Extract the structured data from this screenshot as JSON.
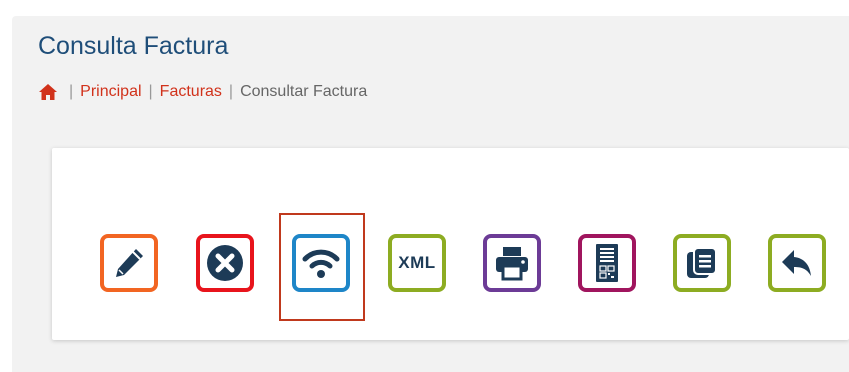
{
  "page": {
    "title": "Consulta Factura"
  },
  "breadcrumb": {
    "home_icon": "home-icon",
    "items": [
      {
        "label": "Principal",
        "link": true
      },
      {
        "label": "Facturas",
        "link": true
      },
      {
        "label": "Consultar Factura",
        "link": false
      }
    ]
  },
  "colors": {
    "title": "#1f4e79",
    "link": "#d1321b",
    "icon_dark": "#1d3b57",
    "edit": "#f26522",
    "cancel": "#e8141c",
    "send": "#1e86c8",
    "xml": "#8dac22",
    "print": "#6c3b96",
    "qr": "#a0155e",
    "copy": "#8dac22",
    "back": "#8dac22",
    "highlight": "#c0391d"
  },
  "actions": [
    {
      "icon": "pencil-icon",
      "name": "edit-button"
    },
    {
      "icon": "close-circle-icon",
      "name": "cancel-button"
    },
    {
      "icon": "wifi-signal-icon",
      "name": "send-button",
      "selected": true
    },
    {
      "icon": "xml-icon",
      "name": "xml-button",
      "text": "XML"
    },
    {
      "icon": "printer-icon",
      "name": "print-button"
    },
    {
      "icon": "qr-document-icon",
      "name": "qr-button"
    },
    {
      "icon": "copy-icon",
      "name": "copy-button"
    },
    {
      "icon": "back-arrow-icon",
      "name": "back-button"
    }
  ]
}
